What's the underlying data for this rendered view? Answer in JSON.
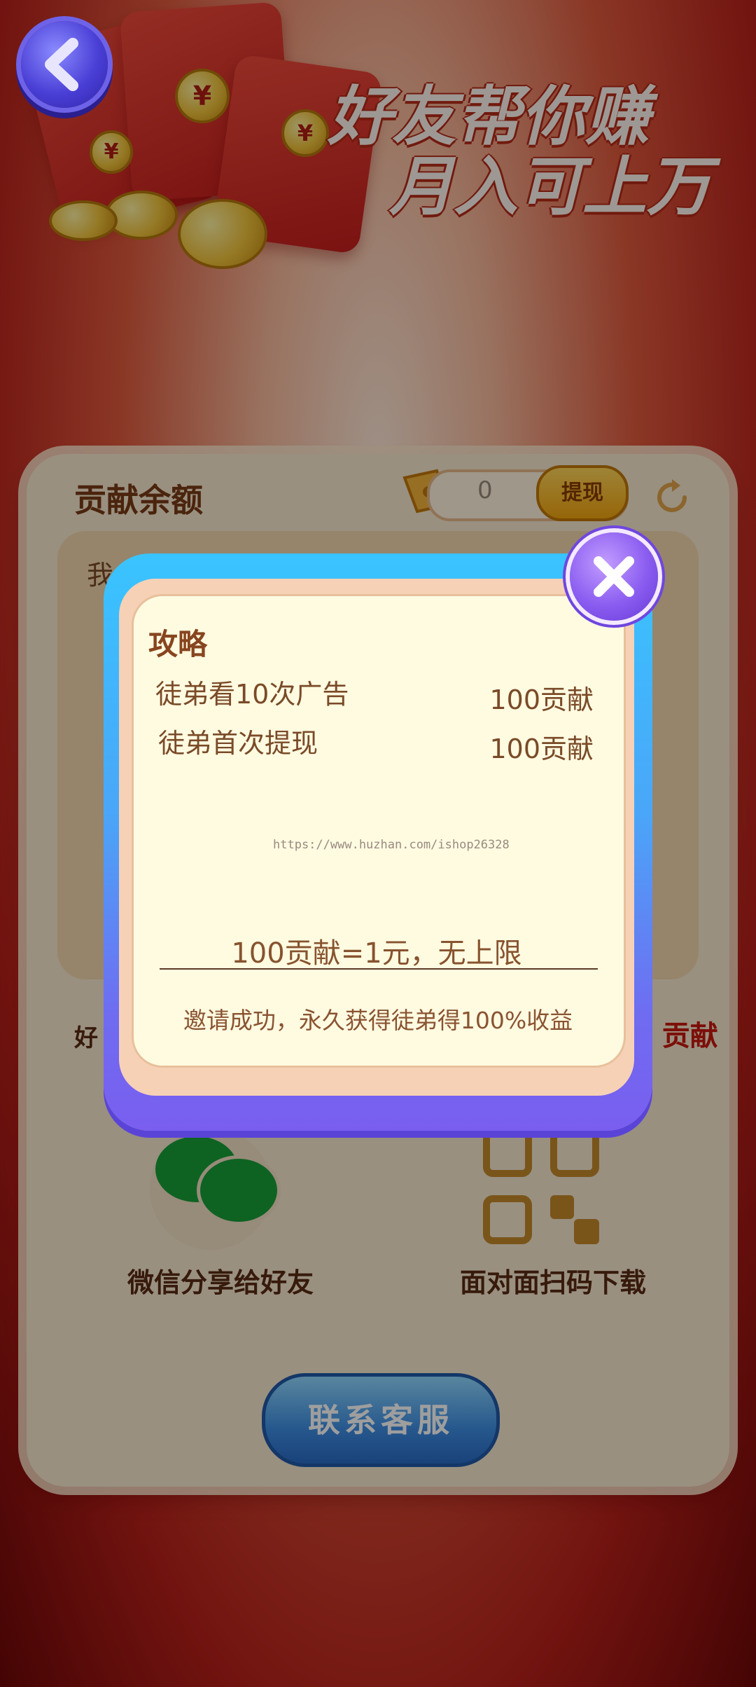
{
  "header": {
    "headline_line1": "好友帮你赚",
    "headline_line2": "月入可上万",
    "coin_symbol": "¥"
  },
  "panel": {
    "title": "贡献余额",
    "balance_value": "0",
    "withdraw_label": "提现",
    "partial_text_left": "我",
    "partial_text_friend": "好",
    "partial_red_right": "0 贡献",
    "wechat_label": "微信分享给好友",
    "qr_label": "面对面扫码下载",
    "contact_label": "联系客服"
  },
  "modal": {
    "title": "攻略",
    "rows": [
      {
        "label": "徒弟看10次广告",
        "value": "100贡献"
      },
      {
        "label": "徒弟首次提现",
        "value": "100贡献"
      }
    ],
    "watermark": "https://www.huzhan.com/ishop26328",
    "rate": "100贡献=1元，无上限",
    "note": "邀请成功，永久获得徒弟得100%收益"
  },
  "colors": {
    "modal_top": "#39c4ff",
    "modal_bottom": "#7a5ef0",
    "body_bg": "#fefbe1",
    "close_btn": "#8a5cf0",
    "back_btn": "#4a3fd6"
  },
  "icons": {
    "back": "chevron-left-icon",
    "close": "close-icon",
    "refresh": "refresh-icon",
    "ticket": "ticket-icon",
    "wechat": "wechat-icon",
    "qr": "qr-code-icon"
  }
}
